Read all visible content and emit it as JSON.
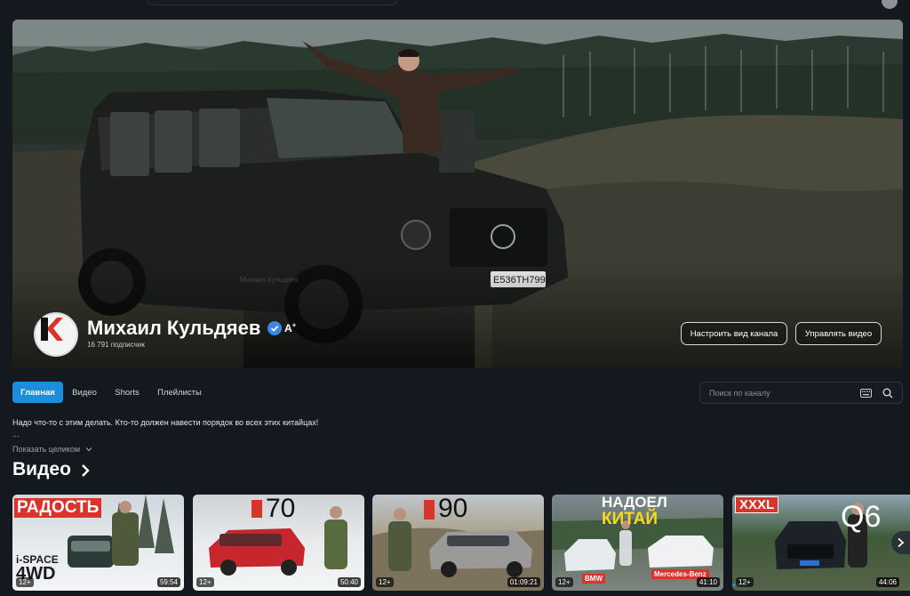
{
  "channel": {
    "name": "Михаил Кульдяев",
    "subscribers": "16 791 подписчик",
    "customize_button": "Настроить вид канала",
    "manage_button": "Управлять видео",
    "watermark": "Михаил Кульдяев"
  },
  "tabs": [
    {
      "label": "Главная",
      "active": true
    },
    {
      "label": "Видео",
      "active": false
    },
    {
      "label": "Shorts",
      "active": false
    },
    {
      "label": "Плейлисты",
      "active": false
    }
  ],
  "search": {
    "placeholder": "Поиск по каналу"
  },
  "about": {
    "description": "Надо что-то с этим делать. Кто-то должен навести порядок во всех этих китайцах!",
    "ellipsis": "...",
    "show_more": "Показать целиком"
  },
  "section": {
    "title": "Видео"
  },
  "videos": [
    {
      "overlay_text": "РАДОСТЬ",
      "overlay_text_2": "i-SPACE",
      "overlay_text_3": "4WD",
      "age": "12+",
      "duration": "59:54"
    },
    {
      "overlay_text": "70",
      "age": "12+",
      "duration": "50:40"
    },
    {
      "overlay_text": "90",
      "age": "12+",
      "duration": "01:09:21"
    },
    {
      "overlay_text": "НАДОЕЛ",
      "overlay_text_2": "КИТАЙ",
      "label_left": "BMW",
      "label_right": "Mercedes-Benz",
      "age": "12+",
      "duration": "41:10"
    },
    {
      "overlay_text": "XXXL",
      "overlay_text_2": "Q6",
      "age": "12+",
      "duration": "44:06"
    }
  ],
  "colors": {
    "accent": "#1b8fdc",
    "background": "#14191f",
    "verified": "#3d86e4"
  }
}
